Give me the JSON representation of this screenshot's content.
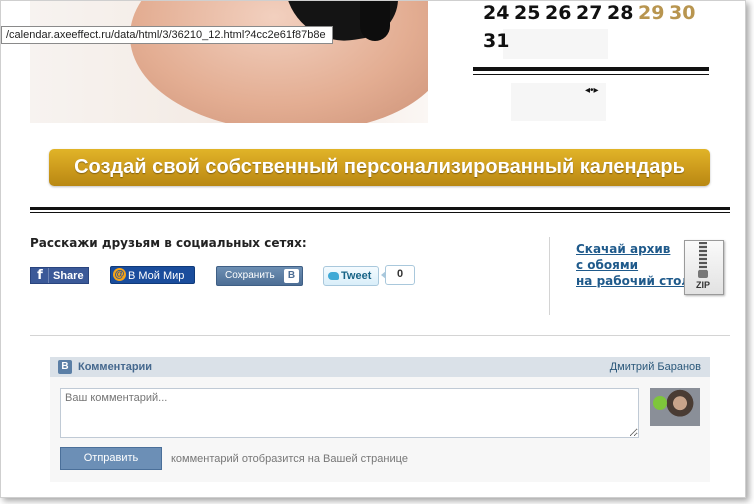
{
  "status_url": "/calendar.axeeffect.ru/data/html/3/36210_12.html?4cc2e61f87b8e",
  "calendar": {
    "row1": [
      "24",
      "25",
      "26",
      "27",
      "28",
      "29",
      "30"
    ],
    "row2": [
      "31"
    ],
    "weekend_color": "#b8954f",
    "nav_symbol": "◂•▸"
  },
  "banner": {
    "label": "Создай свой собственный персонализированный календарь",
    "color": "#d4a421"
  },
  "social": {
    "title": "Расскажи друзьям в социальных сетях:",
    "facebook": {
      "icon": "f",
      "label": "Share"
    },
    "mymir": {
      "icon": "@",
      "label": "В Мой Мир"
    },
    "vk": {
      "label": "Сохранить",
      "icon": "B"
    },
    "twitter": {
      "label": "Tweet",
      "count": "0"
    }
  },
  "download": {
    "lines": [
      "Скачай архив",
      "с обоями",
      "на рабочий стол"
    ],
    "zip_label": "ZIP"
  },
  "comments": {
    "vk_icon": "B",
    "title": "Комментарии",
    "user": "Дмитрий Баранов",
    "placeholder": "Ваш комментарий...",
    "send_label": "Отправить",
    "note": "комментарий отобразится на Вашей странице"
  }
}
